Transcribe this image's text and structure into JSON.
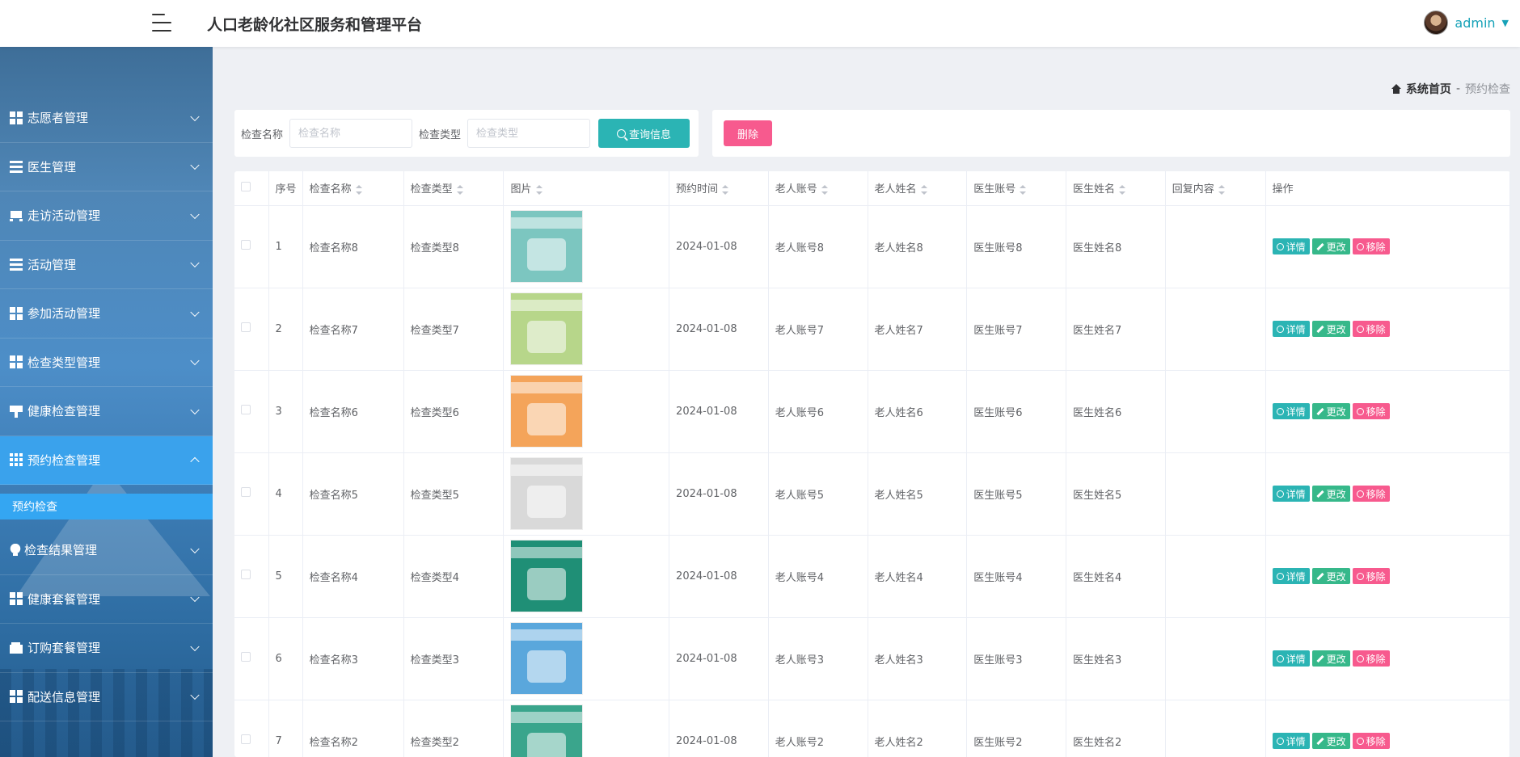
{
  "app": {
    "title": "人口老龄化社区服务和管理平台"
  },
  "user": {
    "name": "admin"
  },
  "sidebar": {
    "items": [
      {
        "label": "志愿者管理",
        "icon": "grid-icon"
      },
      {
        "label": "医生管理",
        "icon": "list-icon"
      },
      {
        "label": "走访活动管理",
        "icon": "car-icon"
      },
      {
        "label": "活动管理",
        "icon": "list-icon"
      },
      {
        "label": "参加活动管理",
        "icon": "grid-icon"
      },
      {
        "label": "检查类型管理",
        "icon": "grid-icon"
      },
      {
        "label": "健康检查管理",
        "icon": "brush-icon"
      },
      {
        "label": "预约检查管理",
        "icon": "grid9-icon",
        "active": true
      },
      {
        "label": "检查结果管理",
        "icon": "bulb-icon"
      },
      {
        "label": "健康套餐管理",
        "icon": "grid-icon"
      },
      {
        "label": "订购套餐管理",
        "icon": "wallet-icon"
      },
      {
        "label": "配送信息管理",
        "icon": "grid-icon"
      }
    ],
    "sub_item": "预约检查"
  },
  "breadcrumb": {
    "home": "系统首页",
    "separator": "-",
    "current": "预约检查"
  },
  "search": {
    "name_label": "检查名称",
    "name_placeholder": "检查名称",
    "type_label": "检查类型",
    "type_placeholder": "检查类型",
    "query_button": "查询信息"
  },
  "actions": {
    "delete_button": "删除"
  },
  "table": {
    "headers": [
      "序号",
      "检查名称",
      "检查类型",
      "图片",
      "预约时间",
      "老人账号",
      "老人姓名",
      "医生账号",
      "医生姓名",
      "回复内容",
      "操作"
    ],
    "rows": [
      {
        "index": "1",
        "name": "检查名称8",
        "type": "检查类型8",
        "time": "2024-01-08",
        "elder_account": "老人账号8",
        "elder_name": "老人姓名8",
        "doctor_account": "医生账号8",
        "doctor_name": "医生姓名8",
        "reply": "",
        "thumb_color": "#7cc6c0"
      },
      {
        "index": "2",
        "name": "检查名称7",
        "type": "检查类型7",
        "time": "2024-01-08",
        "elder_account": "老人账号7",
        "elder_name": "老人姓名7",
        "doctor_account": "医生账号7",
        "doctor_name": "医生姓名7",
        "reply": "",
        "thumb_color": "#b7d68a"
      },
      {
        "index": "3",
        "name": "检查名称6",
        "type": "检查类型6",
        "time": "2024-01-08",
        "elder_account": "老人账号6",
        "elder_name": "老人姓名6",
        "doctor_account": "医生账号6",
        "doctor_name": "医生姓名6",
        "reply": "",
        "thumb_color": "#f4a45a"
      },
      {
        "index": "4",
        "name": "检查名称5",
        "type": "检查类型5",
        "time": "2024-01-08",
        "elder_account": "老人账号5",
        "elder_name": "老人姓名5",
        "doctor_account": "医生账号5",
        "doctor_name": "医生姓名5",
        "reply": "",
        "thumb_color": "#d9d9d9"
      },
      {
        "index": "5",
        "name": "检查名称4",
        "type": "检查类型4",
        "time": "2024-01-08",
        "elder_account": "老人账号4",
        "elder_name": "老人姓名4",
        "doctor_account": "医生账号4",
        "doctor_name": "医生姓名4",
        "reply": "",
        "thumb_color": "#1f8f76"
      },
      {
        "index": "6",
        "name": "检查名称3",
        "type": "检查类型3",
        "time": "2024-01-08",
        "elder_account": "老人账号3",
        "elder_name": "老人姓名3",
        "doctor_account": "医生账号3",
        "doctor_name": "医生姓名3",
        "reply": "",
        "thumb_color": "#5aa7dc"
      },
      {
        "index": "7",
        "name": "检查名称2",
        "type": "检查类型2",
        "time": "2024-01-08",
        "elder_account": "老人账号2",
        "elder_name": "老人姓名2",
        "doctor_account": "医生账号2",
        "doctor_name": "医生姓名2",
        "reply": "",
        "thumb_color": "#3aa58c"
      }
    ],
    "ops": {
      "detail": "详情",
      "edit": "更改",
      "remove": "移除"
    }
  },
  "colors": {
    "accent": "#2bb4b4",
    "danger": "#f75a8e",
    "edit": "#36b88a",
    "sidebar_active": "#3aa2ec"
  }
}
